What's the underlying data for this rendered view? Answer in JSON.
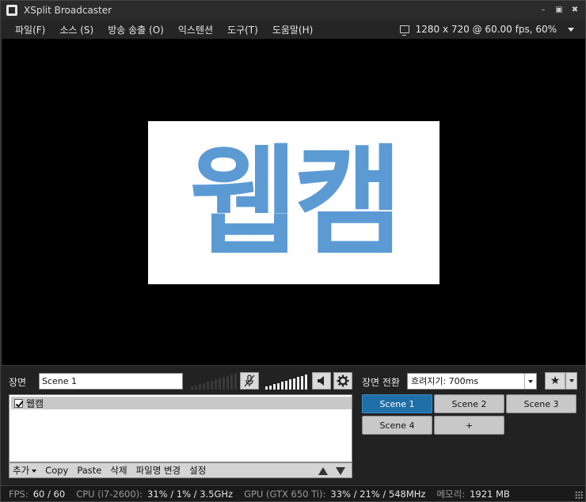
{
  "window": {
    "title": "XSplit Broadcaster"
  },
  "menu": {
    "items": [
      "파일(F)",
      "소스 (S)",
      "방송 송출 (O)",
      "익스텐션",
      "도구(T)",
      "도움말(H)"
    ],
    "resolution": "1280 x 720 @ 60.00 fps, 60%"
  },
  "preview": {
    "source_text": "웹캠",
    "text_color": "#5c9ad4"
  },
  "scene": {
    "label": "장면",
    "name": "Scene 1"
  },
  "sources": {
    "items": [
      {
        "label": "웹캠",
        "checked": true
      }
    ],
    "toolbar": {
      "add": "추가",
      "copy": "Copy",
      "paste": "Paste",
      "delete": "삭제",
      "rename": "파일명 변경",
      "settings": "설정"
    }
  },
  "transition": {
    "label": "장면 전환",
    "selected": "흐려지기: 700ms"
  },
  "scenes": {
    "buttons": [
      "Scene 1",
      "Scene 2",
      "Scene 3",
      "Scene 4",
      "+"
    ],
    "active_color": "#1f6fa8"
  },
  "status": {
    "fps_label": "FPS:",
    "fps_value": "60 / 60",
    "cpu_label": "CPU (i7-2600):",
    "cpu_value": "31% / 1% / 3.5GHz",
    "gpu_label": "GPU (GTX 650 Ti):",
    "gpu_value": "33% / 21% / 548MHz",
    "mem_label": "메모리:",
    "mem_value": "1921 MB"
  }
}
